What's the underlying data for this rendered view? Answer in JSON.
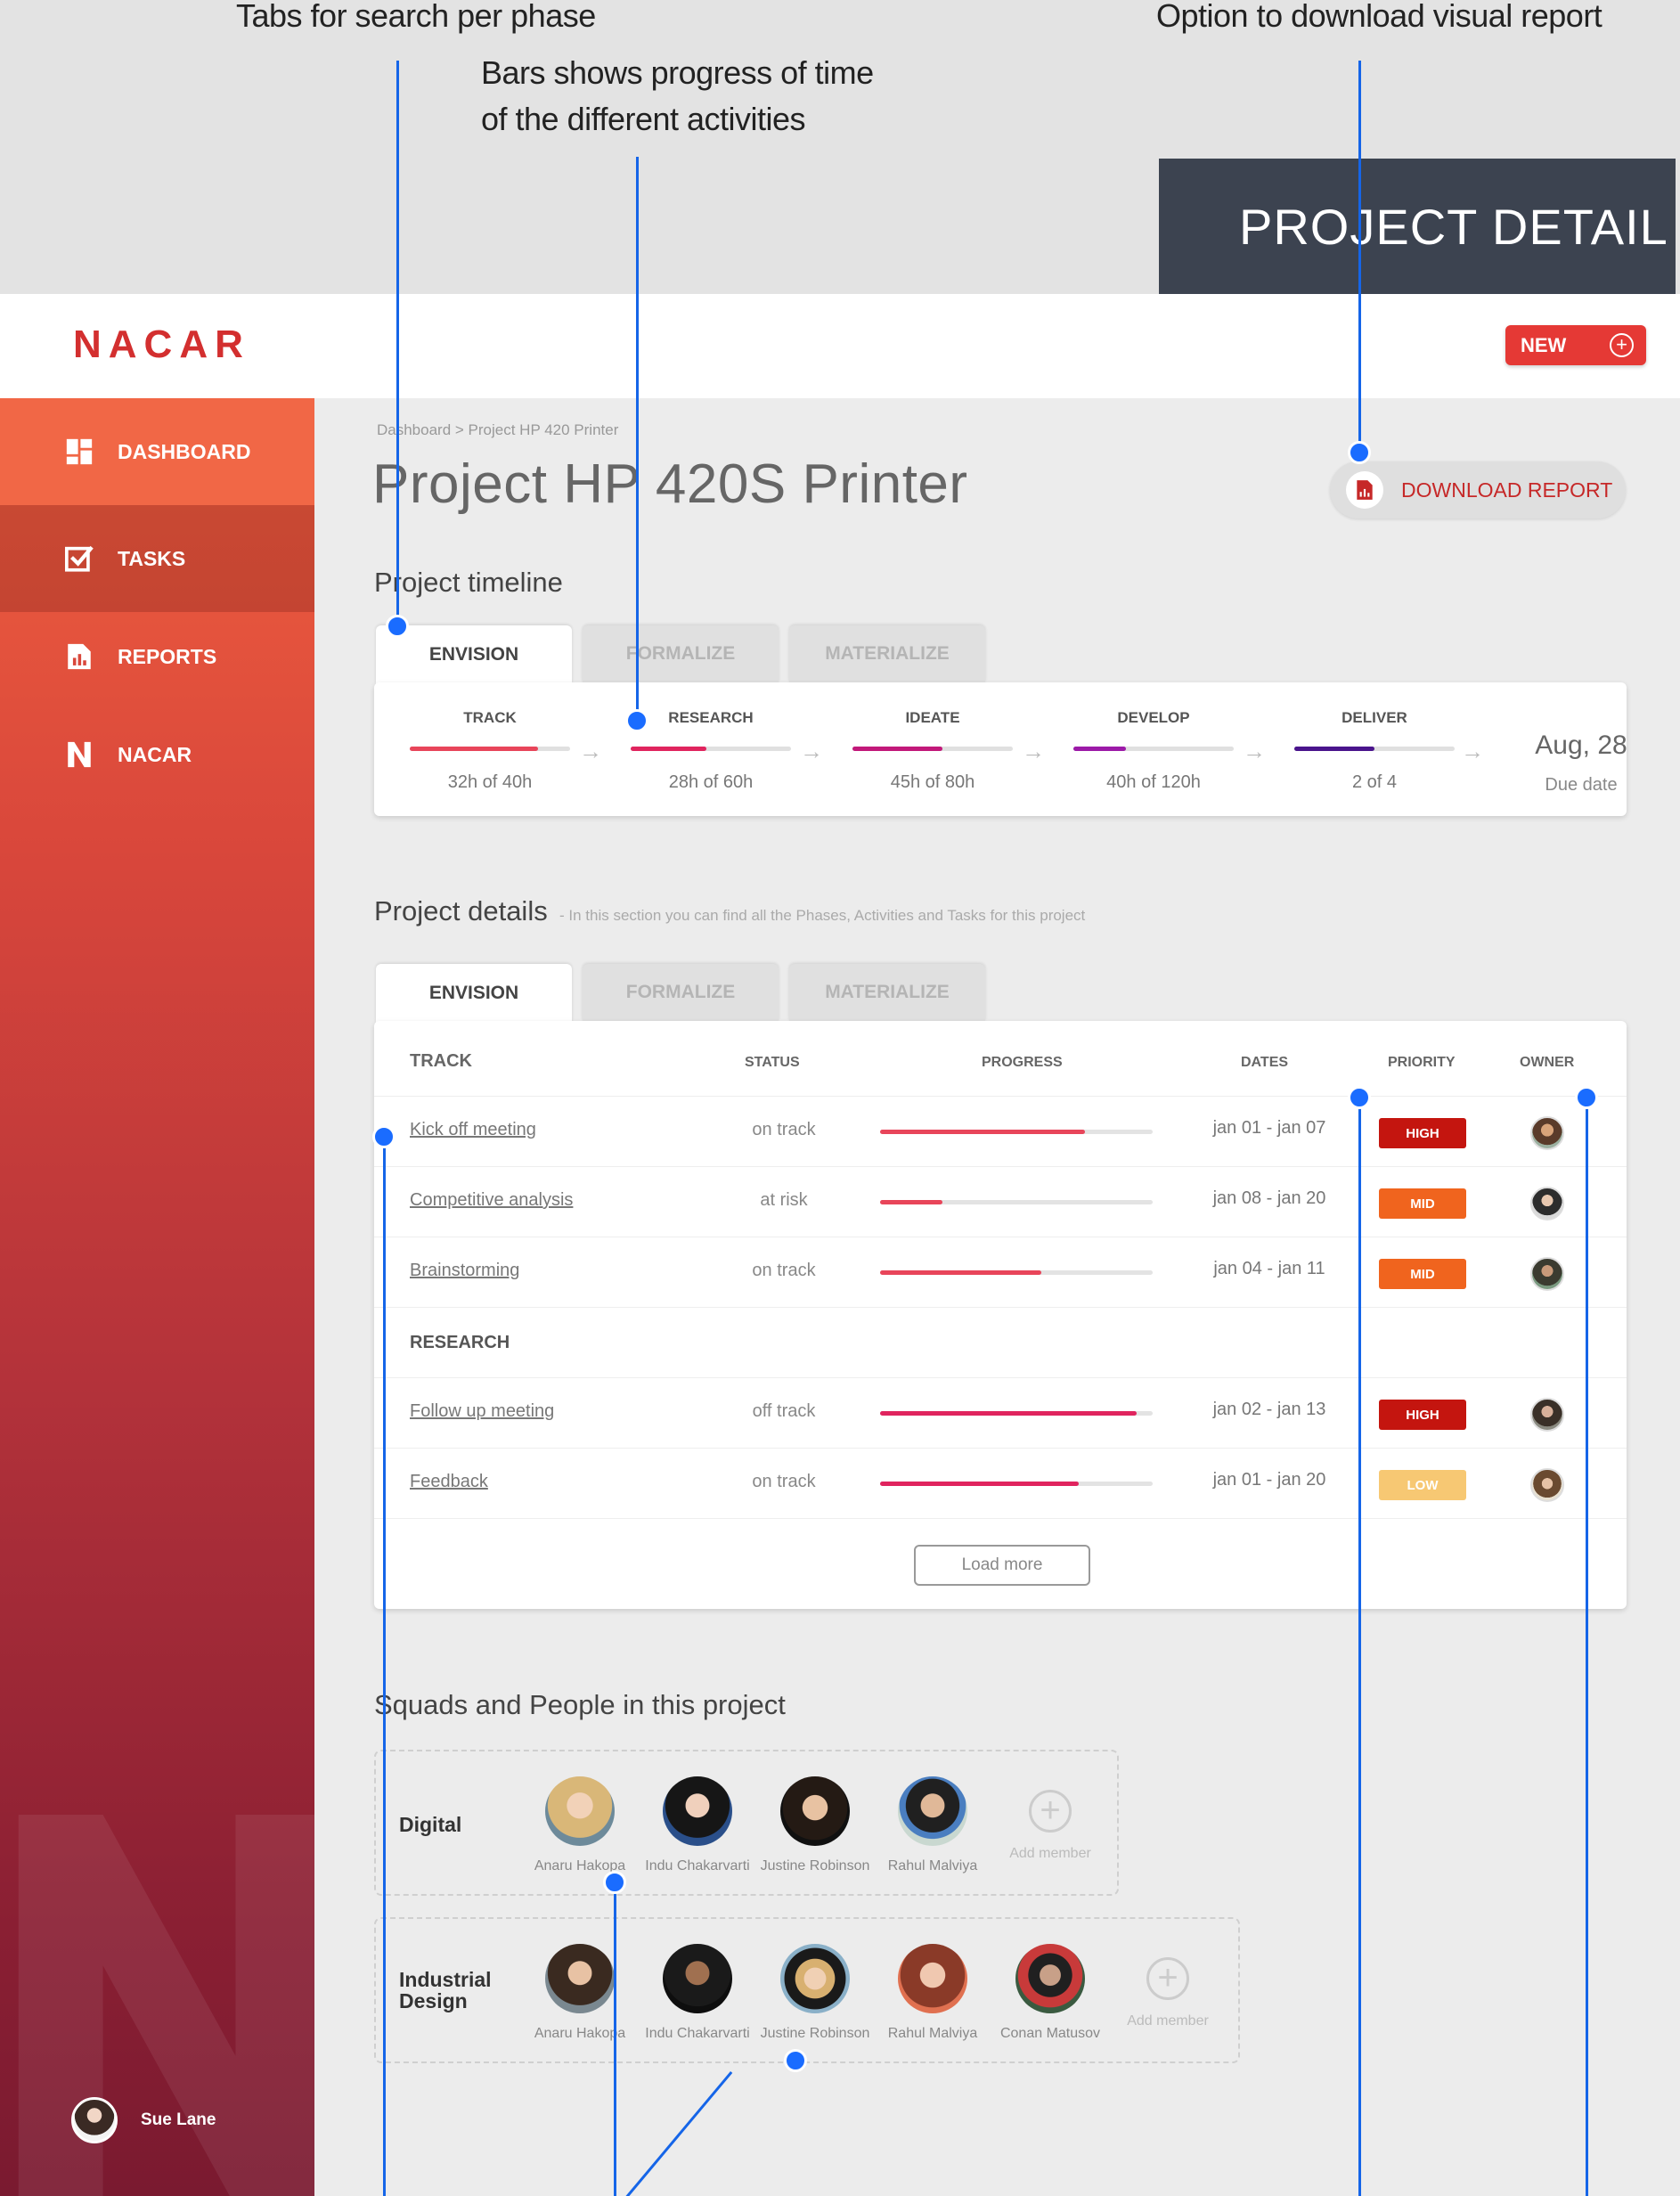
{
  "annotations": {
    "tabs": "Tabs for search per phase",
    "bars": "Bars shows progress of time\nof the different activities",
    "download": "Option to download visual report"
  },
  "banner": "PROJECT DETAIL",
  "app": {
    "logo": "NACAR",
    "new_label": "NEW"
  },
  "sidebar": {
    "items": [
      {
        "label": "DASHBOARD",
        "icon": "dashboard-icon"
      },
      {
        "label": "TASKS",
        "icon": "checkbox-icon"
      },
      {
        "label": "REPORTS",
        "icon": "report-icon"
      },
      {
        "label": "NACAR",
        "icon": "nacar-n-icon"
      }
    ],
    "user": "Sue Lane"
  },
  "breadcrumb": "Dashboard > Project HP 420 Printer",
  "title": "Project HP 420S Printer",
  "download_label": "DOWNLOAD REPORT",
  "timeline": {
    "heading": "Project timeline",
    "tabs": [
      "ENVISION",
      "FORMALIZE",
      "MATERIALIZE"
    ],
    "phases": [
      {
        "name": "TRACK",
        "value": "32h of 40h",
        "progress": 0.8,
        "color": "#e8455a"
      },
      {
        "name": "RESEARCH",
        "value": "28h of 60h",
        "progress": 0.47,
        "color": "#e0245e"
      },
      {
        "name": "IDEATE",
        "value": "45h of 80h",
        "progress": 0.56,
        "color": "#c2187a"
      },
      {
        "name": "DEVELOP",
        "value": "40h of 120h",
        "progress": 0.33,
        "color": "#9c1aa8"
      },
      {
        "name": "DELIVER",
        "value": "2 of 4",
        "progress": 0.5,
        "color": "#4a148c"
      }
    ],
    "due_date": "Aug, 28",
    "due_label": "Due date"
  },
  "details": {
    "heading": "Project details",
    "sub": "-  In this section you can find all the Phases, Activities and Tasks for this project",
    "tabs": [
      "ENVISION",
      "FORMALIZE",
      "MATERIALIZE"
    ],
    "columns": {
      "group": "TRACK",
      "status": "STATUS",
      "progress": "PROGRESS",
      "dates": "DATES",
      "priority": "PRIORITY",
      "owner": "OWNER"
    },
    "groups": [
      {
        "name": "TRACK",
        "rows": [
          {
            "task": "Kick off meeting",
            "status": "on track",
            "progress": 0.75,
            "color": "#e8455a",
            "dates": "jan 01 - jan 07",
            "priority": "HIGH",
            "prio_color": "#c4150f"
          },
          {
            "task": "Competitive analysis",
            "status": "at risk",
            "progress": 0.23,
            "color": "#e8455a",
            "dates": "jan 08 - jan 20",
            "priority": "MID",
            "prio_color": "#f0641e"
          },
          {
            "task": "Brainstorming",
            "status": "on track",
            "progress": 0.59,
            "color": "#e8455a",
            "dates": "jan 04 - jan 11",
            "priority": "MID",
            "prio_color": "#f0641e"
          }
        ]
      },
      {
        "name": "RESEARCH",
        "rows": [
          {
            "task": "Follow up meeting",
            "status": "off track",
            "progress": 0.94,
            "color": "#e0245e",
            "dates": "jan 02 - jan 13",
            "priority": "HIGH",
            "prio_color": "#c4150f"
          },
          {
            "task": "Feedback",
            "status": "on track",
            "progress": 0.73,
            "color": "#e0245e",
            "dates": "jan 01 - jan 20",
            "priority": "LOW",
            "prio_color": "#f7c873"
          }
        ]
      }
    ],
    "load_more": "Load more"
  },
  "squads": {
    "heading": "Squads and People in this project",
    "list": [
      {
        "name": "Digital",
        "members": [
          "Anaru Hakopa",
          "Indu Chakarvarti",
          "Justine Robinson",
          "Rahul Malviya"
        ],
        "add": "Add member"
      },
      {
        "name": "Industrial\nDesign",
        "members": [
          "Anaru Hakopa",
          "Indu Chakarvarti",
          "Justine Robinson",
          "Rahul Malviya",
          "Conan Matusov"
        ],
        "add": "Add member"
      }
    ]
  }
}
